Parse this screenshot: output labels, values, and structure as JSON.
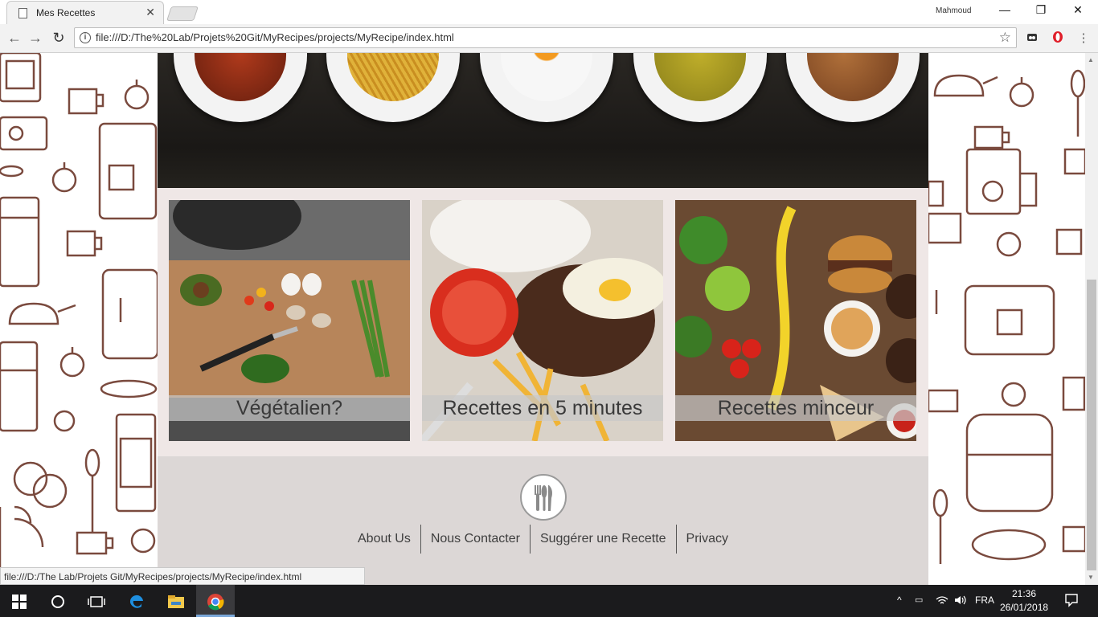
{
  "browser": {
    "tab_title": "Mes Recettes",
    "tab_close": "✕",
    "user_name": "Mahmoud",
    "minimize": "—",
    "restore": "❐",
    "close": "✕",
    "back": "←",
    "forward": "→",
    "reload": "↻",
    "url": "file:///D:/The%20Lab/Projets%20Git/MyRecipes/projects/MyRecipe/index.html",
    "menu": "⋮",
    "status_url": "file:///D:/The Lab/Projets Git/MyRecipes/projects/MyRecipe/index.html"
  },
  "categories": [
    {
      "label": "Végétalien?"
    },
    {
      "label": "Recettes en 5 minutes"
    },
    {
      "label": "Recettes minceur"
    }
  ],
  "footer": {
    "links": [
      "About Us",
      "Nous Contacter",
      "Suggérer une Recette",
      "Privacy"
    ]
  },
  "taskbar": {
    "language": "FRA",
    "time": "21:36",
    "date": "26/01/2018"
  },
  "colors": {
    "icon_brown": "#7a4a3e",
    "category_bg": "#efe7e6",
    "footer_bg": "#dcd7d6"
  }
}
